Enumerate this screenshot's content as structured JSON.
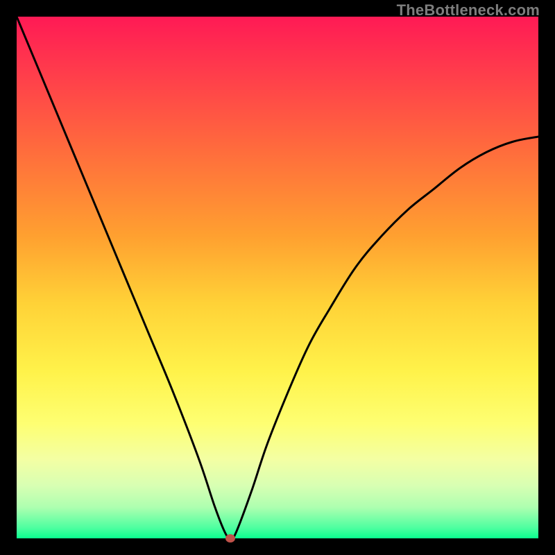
{
  "watermark": "TheBottleneck.com",
  "chart_data": {
    "type": "line",
    "title": "",
    "xlabel": "",
    "ylabel": "",
    "xlim": [
      0,
      100
    ],
    "ylim": [
      0,
      100
    ],
    "grid": false,
    "legend": false,
    "series": [
      {
        "name": "bottleneck-curve",
        "x": [
          0,
          5,
          10,
          15,
          20,
          25,
          30,
          35,
          38,
          40,
          41,
          42,
          45,
          48,
          52,
          56,
          60,
          65,
          70,
          75,
          80,
          85,
          90,
          95,
          100
        ],
        "values": [
          100,
          88,
          76,
          64,
          52,
          40,
          28,
          15,
          6,
          1,
          0,
          1,
          9,
          18,
          28,
          37,
          44,
          52,
          58,
          63,
          67,
          71,
          74,
          76,
          77
        ]
      }
    ],
    "marker": {
      "x": 41,
      "y": 0,
      "color": "#c1524a"
    },
    "background": {
      "type": "vertical-gradient",
      "stops": [
        {
          "pos": 0,
          "color": "#ff1a55"
        },
        {
          "pos": 55,
          "color": "#ffd237"
        },
        {
          "pos": 78,
          "color": "#feff72"
        },
        {
          "pos": 100,
          "color": "#0aff8f"
        }
      ]
    }
  }
}
